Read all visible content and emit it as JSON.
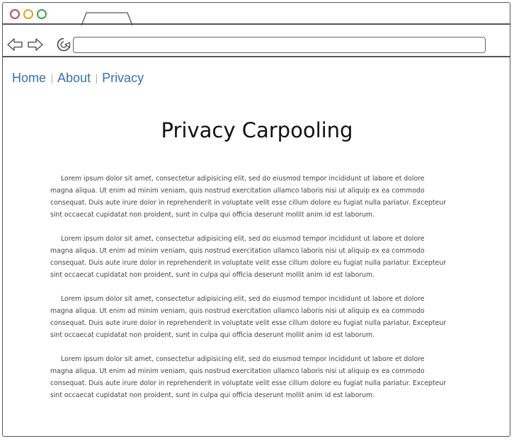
{
  "address_bar": {
    "value": ""
  },
  "nav": {
    "items": [
      {
        "label": "Home"
      },
      {
        "label": "About"
      },
      {
        "label": "Privacy"
      }
    ]
  },
  "main": {
    "title": "Privacy Carpooling",
    "paragraphs": [
      "Lorem ipsum dolor sit amet, consectetur adipisicing elit, sed do eiusmod tempor incididunt ut labore et dolore magna aliqua. Ut enim ad minim veniam, quis nostrud exercitation ullamco laboris nisi ut aliquip ex ea commodo consequat. Duis aute irure dolor in reprehenderit in voluptate velit esse cillum dolore eu fugiat nulla pariatur. Excepteur sint occaecat cupidatat non proident, sunt in culpa qui officia deserunt mollit anim id est laborum.",
      "Lorem ipsum dolor sit amet, consectetur adipisicing elit, sed do eiusmod tempor incididunt ut labore et dolore magna aliqua. Ut enim ad minim veniam, quis nostrud exercitation ullamco laboris nisi ut aliquip ex ea commodo consequat. Duis aute irure dolor in reprehenderit in voluptate velit esse cillum dolore eu fugiat nulla pariatur. Excepteur sint occaecat cupidatat non proident, sunt in culpa qui officia deserunt mollit anim id est laborum.",
      "Lorem ipsum dolor sit amet, consectetur adipisicing elit, sed do eiusmod tempor incididunt ut labore et dolore magna aliqua. Ut enim ad minim veniam, quis nostrud exercitation ullamco laboris nisi ut aliquip ex ea commodo consequat. Duis aute irure dolor in reprehenderit in voluptate velit esse cillum dolore eu fugiat nulla pariatur. Excepteur sint occaecat cupidatat non proident, sunt in culpa qui officia deserunt mollit anim id est laborum.",
      "Lorem ipsum dolor sit amet, consectetur adipisicing elit, sed do eiusmod tempor incididunt ut labore et dolore magna aliqua. Ut enim ad minim veniam, quis nostrud exercitation ullamco laboris nisi ut aliquip ex ea commodo consequat. Duis aute irure dolor in reprehenderit in voluptate velit esse cillum dolore eu fugiat nulla pariatur. Excepteur sint occaecat cupidatat non proident, sunt in culpa qui officia deserunt mollit anim id est laborum."
    ]
  },
  "icons": {
    "window_close": "close-dot-icon",
    "window_minimize": "minimize-dot-icon",
    "window_maximize": "maximize-dot-icon",
    "back": "arrow-left-icon",
    "forward": "arrow-right-icon",
    "reload": "reload-icon"
  },
  "colors": {
    "close": "#c84a4a",
    "minimize": "#d9a520",
    "maximize": "#3aa54a",
    "link": "#3b6fb0",
    "border": "#555555"
  }
}
